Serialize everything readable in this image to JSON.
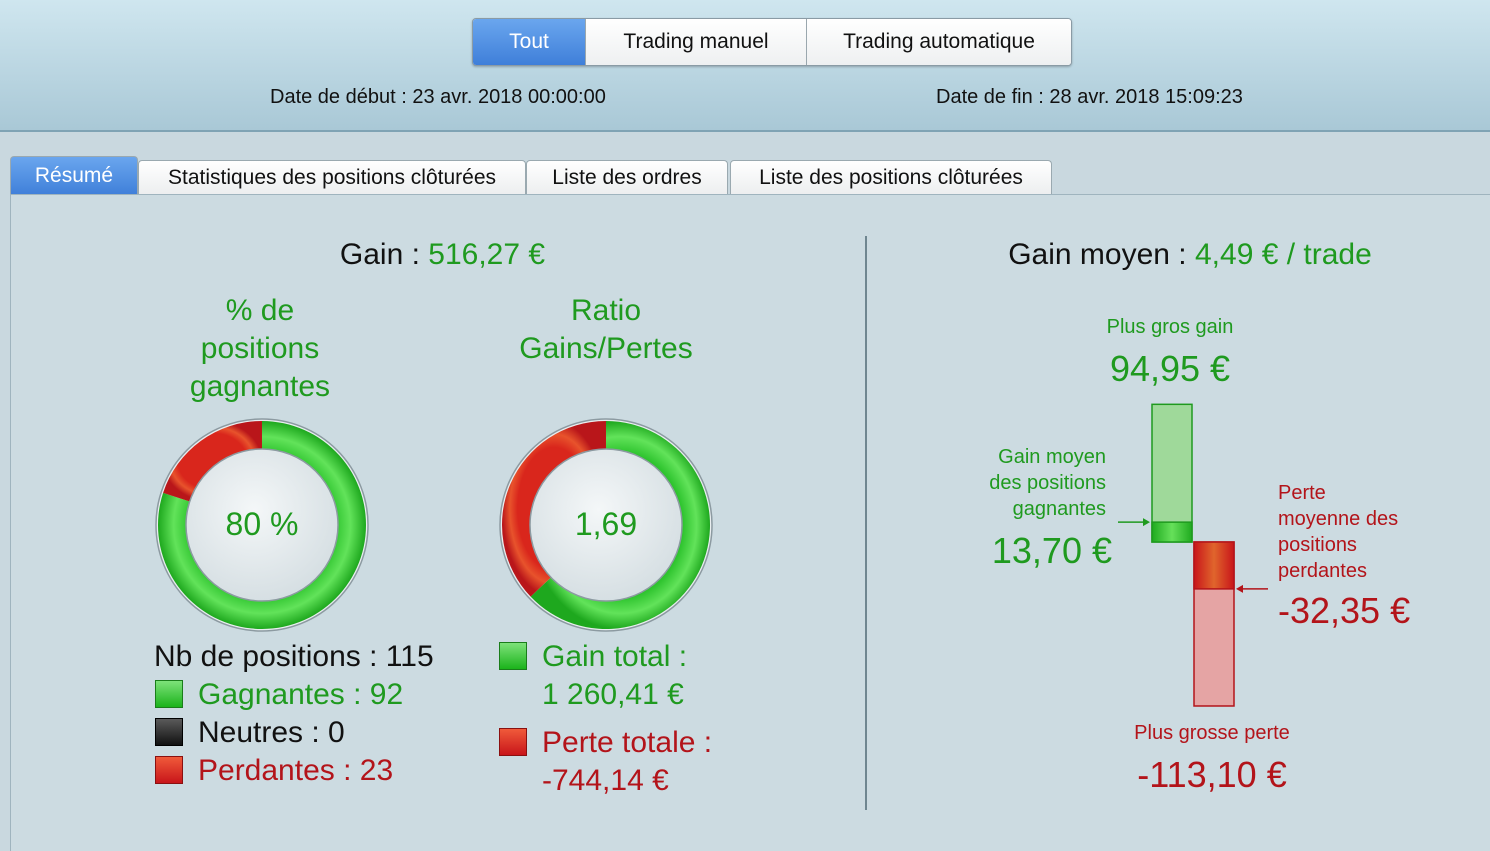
{
  "header": {
    "segments": [
      {
        "label": "Tout",
        "active": true
      },
      {
        "label": "Trading manuel",
        "active": false
      },
      {
        "label": "Trading automatique",
        "active": false
      }
    ],
    "start_label": "Date de début :",
    "start_value": "23 avr. 2018 00:00:00",
    "end_label": "Date de fin :",
    "end_value": "28 avr. 2018 15:09:23"
  },
  "tabs": [
    {
      "label": "Résumé",
      "active": true
    },
    {
      "label": "Statistiques des positions clôturées",
      "active": false
    },
    {
      "label": "Liste des ordres",
      "active": false
    },
    {
      "label": "Liste des positions clôturées",
      "active": false
    }
  ],
  "summary": {
    "gain_label": "Gain :",
    "gain_value": "516,27 €",
    "win_title_1": "% de",
    "win_title_2": "positions",
    "win_title_3": "gagnantes",
    "win_pct_text": "80 %",
    "win_fraction": 0.8,
    "ratio_title_1": "Ratio",
    "ratio_title_2": "Gains/Pertes",
    "ratio_text": "1,69",
    "gain_fraction": 0.629,
    "nb_positions": "Nb de positions : 115",
    "winners": "Gagnantes : 92",
    "neutral": "Neutres : 0",
    "losers": "Perdantes : 23",
    "total_gain_label": "Gain total :",
    "total_gain_value": "1 260,41 €",
    "total_loss_label": "Perte totale :",
    "total_loss_value": "-744,14 €"
  },
  "average": {
    "title_label": "Gain moyen :",
    "title_value": "4,49 € / trade",
    "max_gain_label": "Plus gros gain",
    "max_gain_value": "94,95 €",
    "max_gain": 94.95,
    "avg_win_line1": "Gain moyen",
    "avg_win_line2": "des positions",
    "avg_win_line3": "gagnantes",
    "avg_win_value": "13,70 €",
    "avg_win": 13.7,
    "avg_loss_line1": "Perte",
    "avg_loss_line2": "moyenne des",
    "avg_loss_line3": "positions",
    "avg_loss_line4": "perdantes",
    "avg_loss_value": "-32,35 €",
    "avg_loss": -32.35,
    "max_loss_label": "Plus grosse perte",
    "max_loss_value": "-113,10 €",
    "max_loss": -113.1
  },
  "colors": {
    "green": "#1f9a1f",
    "red": "#b3141a",
    "active_blue": "#3f7fd9"
  }
}
